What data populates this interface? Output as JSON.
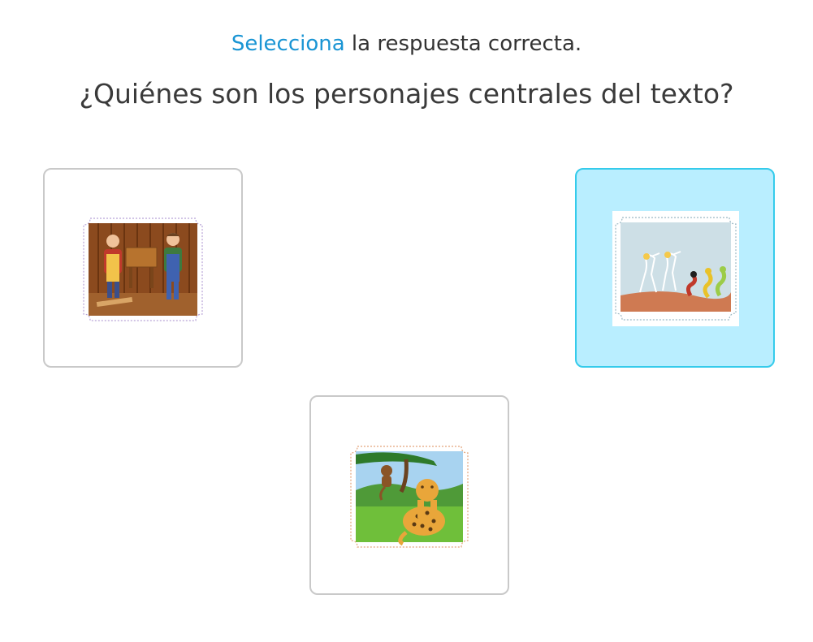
{
  "prompt": {
    "verb": "Selecciona",
    "rest": " la respuesta correcta.",
    "question": "¿Quiénes son los personajes centrales del texto?"
  },
  "options": [
    {
      "subject": "carpenters in a wood workshop",
      "selected": false
    },
    {
      "subject": "herons and snakes by a lake",
      "selected": true
    },
    {
      "subject": "monkey in a tree and a jaguar in the jungle",
      "selected": false
    }
  ],
  "colors": {
    "accent": "#1a95d4",
    "selected_bg": "#b9eeff",
    "selected_border": "#35cbeb",
    "card_border": "#c9c9c9"
  }
}
